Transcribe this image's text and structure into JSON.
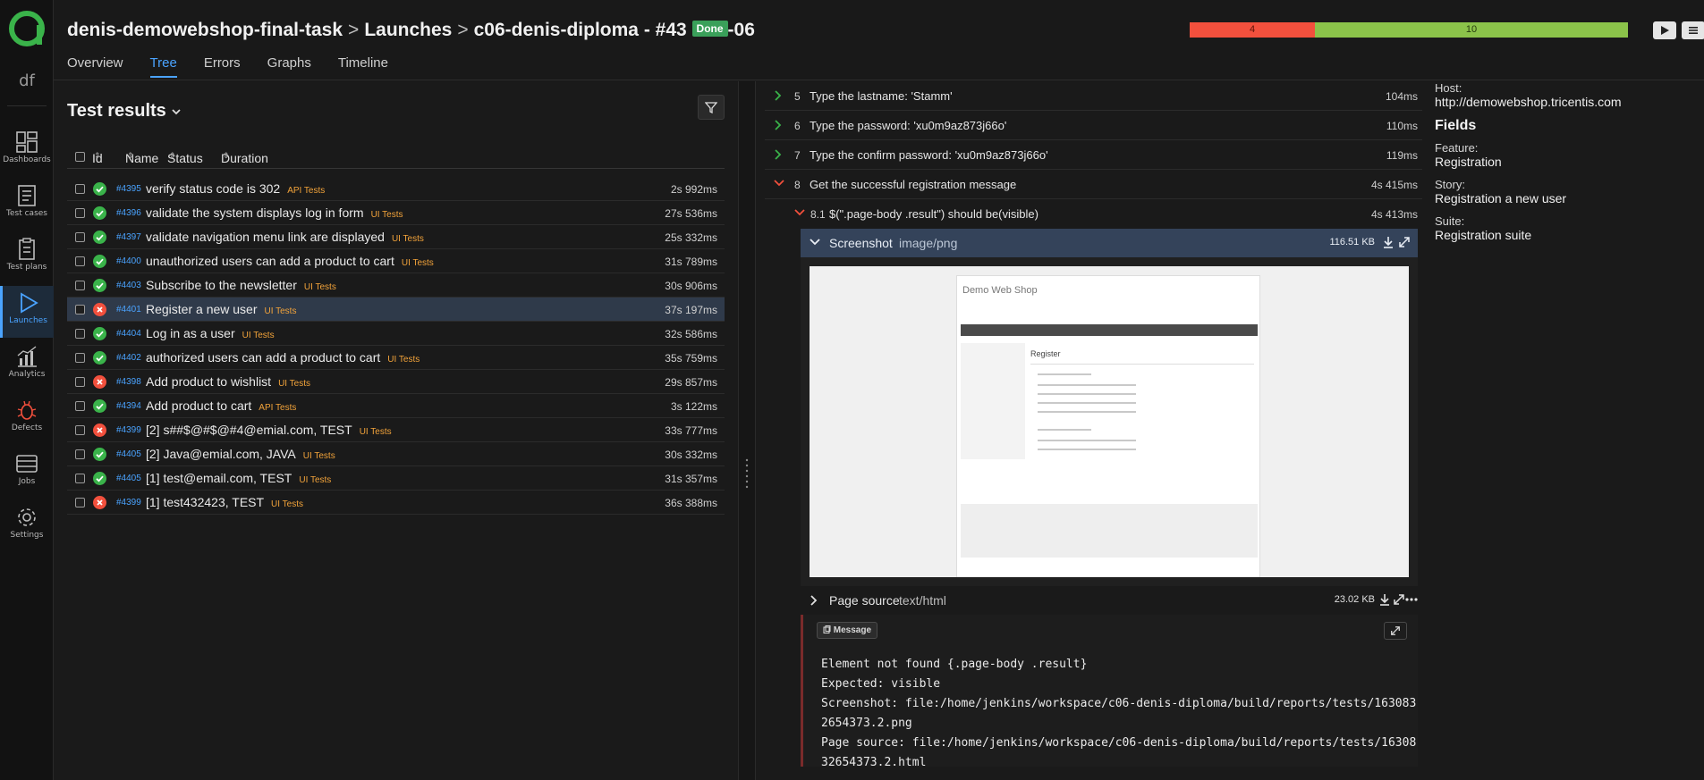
{
  "nav": {
    "project_initials": "df",
    "items": [
      {
        "label": "Dashboards"
      },
      {
        "label": "Test cases"
      },
      {
        "label": "Test plans"
      },
      {
        "label": "Launches"
      },
      {
        "label": "Analytics"
      },
      {
        "label": "Defects"
      },
      {
        "label": "Jobs"
      },
      {
        "label": "Settings"
      }
    ]
  },
  "header": {
    "project": "denis-demowebshop-final-task",
    "launches": "Launches",
    "launch_name": "c06-denis-diploma - #43",
    "status_badge": "Done",
    "launch_suffix": "-06",
    "tabs": [
      "Overview",
      "Tree",
      "Errors",
      "Graphs",
      "Timeline"
    ],
    "active_tab": "Tree",
    "stats": {
      "failed": 4,
      "passed": 10
    }
  },
  "results": {
    "title": "Test results",
    "columns": {
      "id": "Id",
      "name": "Name",
      "status": "Status",
      "duration": "Duration"
    },
    "rows": [
      {
        "id": "#4395",
        "name": "verify status code is 302",
        "tag": "API Tests",
        "status": "passed",
        "duration": "2s 992ms"
      },
      {
        "id": "#4396",
        "name": "validate the system displays log in form",
        "tag": "UI Tests",
        "status": "passed",
        "duration": "27s 536ms"
      },
      {
        "id": "#4397",
        "name": "validate navigation menu link are displayed",
        "tag": "UI Tests",
        "status": "passed",
        "duration": "25s 332ms"
      },
      {
        "id": "#4400",
        "name": "unauthorized users can add a product to cart",
        "tag": "UI Tests",
        "status": "passed",
        "duration": "31s 789ms"
      },
      {
        "id": "#4403",
        "name": "Subscribe to the newsletter",
        "tag": "UI Tests",
        "status": "passed",
        "duration": "30s 906ms"
      },
      {
        "id": "#4401",
        "name": "Register a new user",
        "tag": "UI Tests",
        "status": "failed",
        "duration": "37s 197ms",
        "selected": true
      },
      {
        "id": "#4404",
        "name": "Log in as a user",
        "tag": "UI Tests",
        "status": "passed",
        "duration": "32s 586ms"
      },
      {
        "id": "#4402",
        "name": "authorized users can add a product to cart",
        "tag": "UI Tests",
        "status": "passed",
        "duration": "35s 759ms"
      },
      {
        "id": "#4398",
        "name": "Add product to wishlist",
        "tag": "UI Tests",
        "status": "failed",
        "duration": "29s 857ms"
      },
      {
        "id": "#4394",
        "name": "Add product to cart",
        "tag": "API Tests",
        "status": "passed",
        "duration": "3s 122ms"
      },
      {
        "id": "#4399",
        "name": "[2] s##$@#$@#4@emial.com, TEST",
        "tag": "UI Tests",
        "status": "failed",
        "duration": "33s 777ms"
      },
      {
        "id": "#4405",
        "name": "[2] Java@emial.com, JAVA",
        "tag": "UI Tests",
        "status": "passed",
        "duration": "30s 332ms"
      },
      {
        "id": "#4405",
        "name": "[1] test@email.com, TEST",
        "tag": "UI Tests",
        "status": "passed",
        "duration": "31s 357ms"
      },
      {
        "id": "#4399",
        "name": "[1] test432423, TEST",
        "tag": "UI Tests",
        "status": "failed",
        "duration": "36s 388ms"
      }
    ]
  },
  "steps": [
    {
      "num": "5",
      "text": "Type the lastname: 'Stamm'",
      "duration": "104ms",
      "status": "passed"
    },
    {
      "num": "6",
      "text": "Type the password: 'xu0m9az873j66o'",
      "duration": "110ms",
      "status": "passed"
    },
    {
      "num": "7",
      "text": "Type the confirm password: 'xu0m9az873j66o'",
      "duration": "119ms",
      "status": "passed"
    },
    {
      "num": "8",
      "text": "Get the successful registration message",
      "duration": "4s 415ms",
      "status": "failed",
      "expanded": true
    }
  ],
  "substep": {
    "num": "8.1",
    "text": "$(\".page-body .result\") should be(visible)",
    "duration": "4s 413ms"
  },
  "attachment": {
    "title": "Screenshot",
    "mime": "image/png",
    "size": "116.51 KB"
  },
  "screenshot": {
    "site_title": "Demo Web Shop",
    "page_heading": "Register"
  },
  "page_source": {
    "title": "Page source",
    "mime": "text/html",
    "size": "23.02 KB"
  },
  "message": {
    "button": "Message",
    "lines": [
      "Element not found {.page-body .result}",
      "Expected: visible",
      "Screenshot: file:/home/jenkins/workspace/c06-denis-diploma/build/reports/tests/163083",
      "2654373.2.png",
      "Page source: file:/home/jenkins/workspace/c06-denis-diploma/build/reports/tests/16308",
      "32654373.2.html"
    ]
  },
  "info": {
    "host_label": "Host:",
    "host": "http://demowebshop.tricentis.com",
    "fields_heading": "Fields",
    "feature_label": "Feature:",
    "feature": "Registration",
    "story_label": "Story:",
    "story": "Registration a new user",
    "suite_label": "Suite:",
    "suite": "Registration suite"
  },
  "colors": {
    "passed": "#3ab34a",
    "failed": "#f2503d",
    "accent": "#4aa3ff",
    "tag": "#f2a33a"
  }
}
